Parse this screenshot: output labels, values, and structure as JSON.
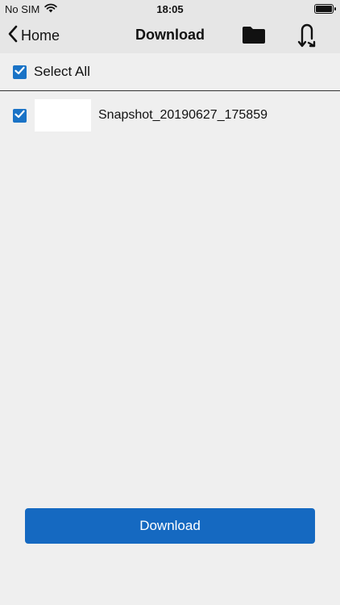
{
  "status_bar": {
    "carrier": "No SIM",
    "time": "18:05",
    "wifi_icon": "wifi-icon",
    "battery_icon": "battery-icon"
  },
  "nav": {
    "back_label": "Home",
    "title": "Download",
    "folder_icon": "folder-icon",
    "undo_icon": "undo-arrow-icon"
  },
  "select_all": {
    "label": "Select All",
    "checked": true
  },
  "files": [
    {
      "name": "Snapshot_20190627_175859",
      "checked": true
    }
  ],
  "download_button": {
    "label": "Download"
  },
  "colors": {
    "accent": "#1569c1",
    "checkbox": "#1a73c6",
    "bar_background": "#e6e6e6",
    "page_background": "#efefef"
  }
}
